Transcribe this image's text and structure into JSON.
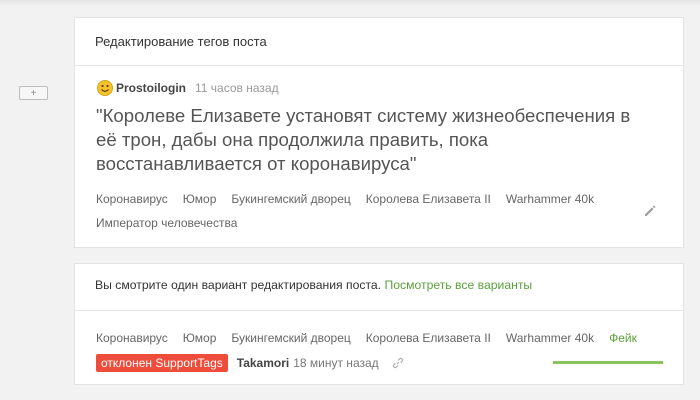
{
  "header": {
    "title": "Редактирование тегов поста"
  },
  "post": {
    "author": "Prostoilogin",
    "time": "11 часов назад",
    "title": "\"Королеве Елизавете установят систему жизнеобеспечения в её трон, дабы она продолжила править, пока восстанавливается от коронавируса\"",
    "tags": [
      "Коронавирус",
      "Юмор",
      "Букингемский дворец",
      "Королева Елизавета II",
      "Warhammer 40k",
      "Император человечества"
    ]
  },
  "variant": {
    "text": "Вы смотрите один вариант редактирования поста.",
    "link": "Посмотреть все варианты",
    "tags": [
      "Коронавирус",
      "Юмор",
      "Букингемский дворец",
      "Королева Елизавета II",
      "Warhammer 40k"
    ],
    "added_tag": "Фейк",
    "status": "отклонен SupportTags",
    "editor": "Takamori",
    "edit_time": "18 минут назад",
    "vote_fraction": 1.0
  },
  "controls": {
    "expand_label": "+"
  },
  "colors": {
    "accent_green": "#5ba13a",
    "reject_red": "#ee4d3c",
    "bar_green": "#8ac25c"
  },
  "icons": {
    "avatar": "smiley-avatar-icon",
    "edit": "pencil-icon",
    "link": "link-icon"
  }
}
